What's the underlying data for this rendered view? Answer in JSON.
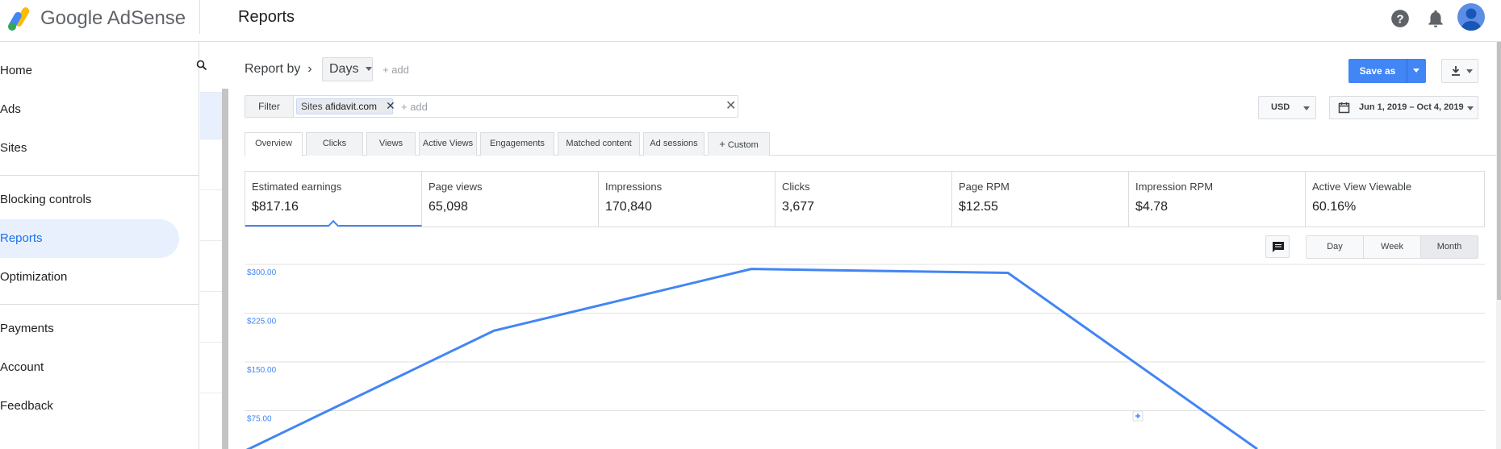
{
  "header": {
    "brand": "Google AdSense",
    "page_title": "Reports",
    "icons": [
      "help-icon",
      "notifications-icon",
      "account-avatar"
    ]
  },
  "sidebar": {
    "items": [
      {
        "label": "Home"
      },
      {
        "label": "Ads"
      },
      {
        "label": "Sites"
      },
      {
        "label": "Blocking controls"
      },
      {
        "label": "Reports",
        "active": true
      },
      {
        "label": "Optimization"
      },
      {
        "label": "Payments"
      },
      {
        "label": "Account"
      },
      {
        "label": "Feedback"
      }
    ]
  },
  "toolbar": {
    "report_by": "Report by",
    "dimension": "Days",
    "add": "+ add",
    "save_label": "Save as",
    "currency": "USD",
    "date_range": "Jun 1, 2019 – Oct 4, 2019"
  },
  "filter": {
    "label": "Filter",
    "chip_key": "Sites",
    "chip_value": "afidavit.com",
    "add_placeholder": "+ add"
  },
  "tabs": [
    "Overview",
    "Clicks",
    "Views",
    "Active Views",
    "Engagements",
    "Matched content",
    "Ad sessions",
    "Custom"
  ],
  "metrics": [
    {
      "label": "Estimated earnings",
      "value": "$817.16"
    },
    {
      "label": "Page views",
      "value": "65,098"
    },
    {
      "label": "Impressions",
      "value": "170,840"
    },
    {
      "label": "Clicks",
      "value": "3,677"
    },
    {
      "label": "Page RPM",
      "value": "$12.55"
    },
    {
      "label": "Impression RPM",
      "value": "$4.78"
    },
    {
      "label": "Active View Viewable",
      "value": "60.16%"
    }
  ],
  "period": {
    "options": [
      "Day",
      "Week",
      "Month"
    ],
    "selected": "Month"
  },
  "colors": {
    "accent": "#4285f4",
    "active_bg": "#e8f0fe",
    "active_text": "#1a73e8"
  },
  "chart_data": {
    "type": "line",
    "title": "",
    "xlabel": "",
    "ylabel": "",
    "y_ticks": [
      "$300.00",
      "$225.00",
      "$150.00",
      "$75.00"
    ],
    "ylim": [
      0,
      300
    ],
    "series": [
      {
        "values": [
          13,
          198,
          293,
          287,
          16
        ]
      }
    ],
    "color": "#4285f4",
    "grid": true
  }
}
